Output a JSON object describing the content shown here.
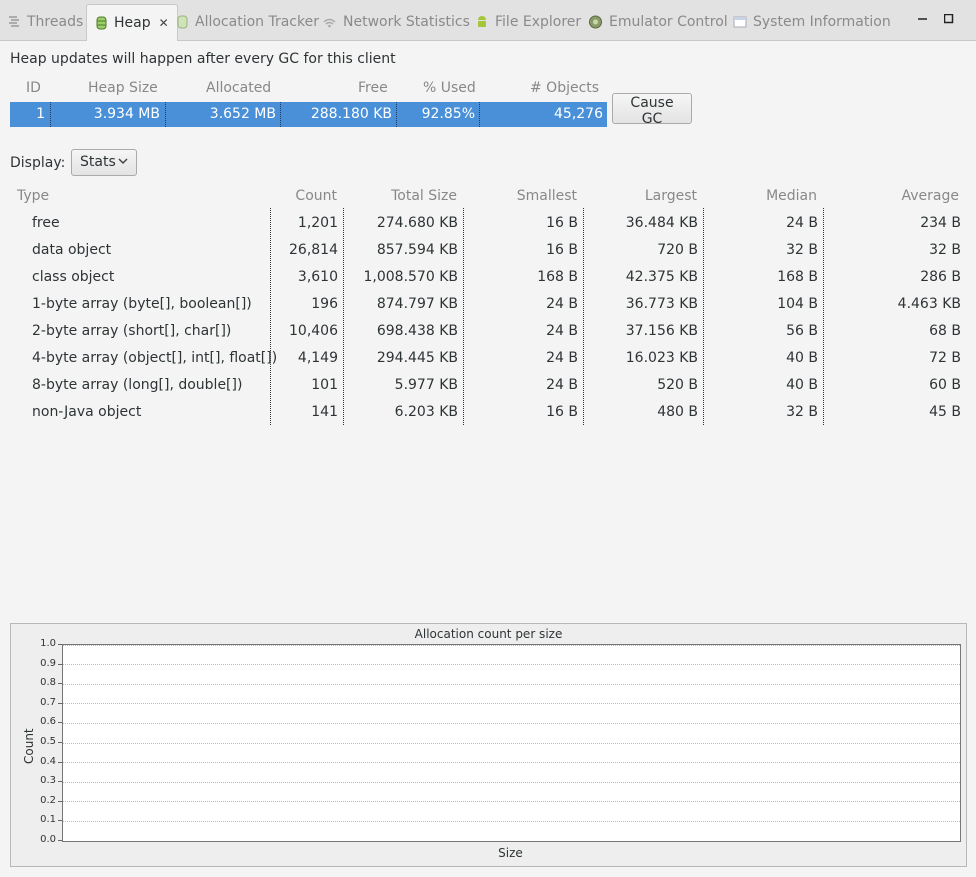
{
  "tabs": [
    {
      "label": "Threads",
      "icon": "threads-icon"
    },
    {
      "label": "Heap",
      "icon": "heap-icon",
      "active": true
    },
    {
      "label": "Allocation Tracker",
      "icon": "allocation-icon"
    },
    {
      "label": "Network Statistics",
      "icon": "network-icon"
    },
    {
      "label": "File Explorer",
      "icon": "android-icon"
    },
    {
      "label": "Emulator Control",
      "icon": "emulator-icon"
    },
    {
      "label": "System Information",
      "icon": "window-icon"
    }
  ],
  "window_controls": {
    "minimize": "minimize-icon",
    "maximize": "maximize-icon"
  },
  "info_text": "Heap updates will happen after every GC for this client",
  "summary": {
    "headers": {
      "id": "ID",
      "heap_size": "Heap Size",
      "allocated": "Allocated",
      "free": "Free",
      "used": "% Used",
      "objects": "# Objects"
    },
    "row": {
      "id": "1",
      "heap_size": "3.934 MB",
      "allocated": "3.652 MB",
      "free": "288.180 KB",
      "used": "92.85%",
      "objects": "45,276"
    }
  },
  "cause_gc_label": "Cause GC",
  "display": {
    "label": "Display:",
    "selected": "Stats"
  },
  "table": {
    "headers": {
      "type": "Type",
      "count": "Count",
      "total": "Total Size",
      "smallest": "Smallest",
      "largest": "Largest",
      "median": "Median",
      "average": "Average"
    },
    "rows": [
      {
        "type": "free",
        "count": "1,201",
        "total": "274.680 KB",
        "smallest": "16 B",
        "largest": "36.484 KB",
        "median": "24 B",
        "average": "234 B"
      },
      {
        "type": "data object",
        "count": "26,814",
        "total": "857.594 KB",
        "smallest": "16 B",
        "largest": "720 B",
        "median": "32 B",
        "average": "32 B"
      },
      {
        "type": "class object",
        "count": "3,610",
        "total": "1,008.570 KB",
        "smallest": "168 B",
        "largest": "42.375 KB",
        "median": "168 B",
        "average": "286 B"
      },
      {
        "type": "1-byte array (byte[], boolean[])",
        "count": "196",
        "total": "874.797 KB",
        "smallest": "24 B",
        "largest": "36.773 KB",
        "median": "104 B",
        "average": "4.463 KB"
      },
      {
        "type": "2-byte array (short[], char[])",
        "count": "10,406",
        "total": "698.438 KB",
        "smallest": "24 B",
        "largest": "37.156 KB",
        "median": "56 B",
        "average": "68 B"
      },
      {
        "type": "4-byte array (object[], int[], float[])",
        "count": "4,149",
        "total": "294.445 KB",
        "smallest": "24 B",
        "largest": "16.023 KB",
        "median": "40 B",
        "average": "72 B"
      },
      {
        "type": "8-byte array (long[], double[])",
        "count": "101",
        "total": "5.977 KB",
        "smallest": "24 B",
        "largest": "520 B",
        "median": "40 B",
        "average": "60 B"
      },
      {
        "type": "non-Java object",
        "count": "141",
        "total": "6.203 KB",
        "smallest": "16 B",
        "largest": "480 B",
        "median": "32 B",
        "average": "45 B"
      }
    ]
  },
  "chart_data": {
    "type": "bar",
    "title": "Allocation count per size",
    "xlabel": "Size",
    "ylabel": "Count",
    "ylim": [
      0,
      1.0
    ],
    "yticks": [
      "0.0",
      "0.1",
      "0.2",
      "0.3",
      "0.4",
      "0.5",
      "0.6",
      "0.7",
      "0.8",
      "0.9",
      "1.0"
    ],
    "categories": [],
    "values": [],
    "grid": true
  }
}
